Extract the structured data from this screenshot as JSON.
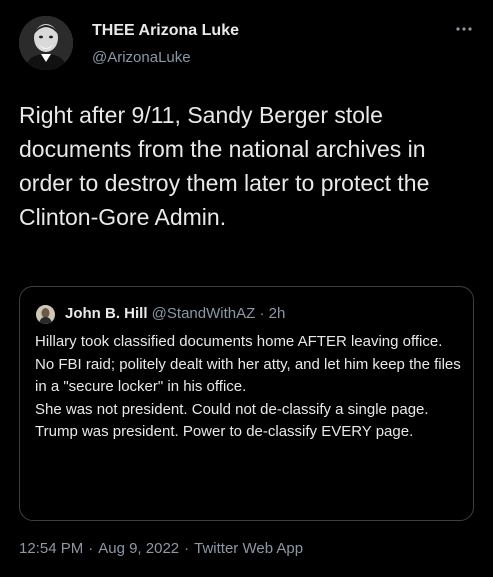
{
  "tweet": {
    "author": {
      "display_name": "THEE Arizona Luke",
      "handle": "@ArizonaLuke",
      "avatar_icon": "user-avatar"
    },
    "more_icon": "more-options-icon",
    "text": "Right after 9/11, Sandy Berger stole documents from the national archives in order to destroy them later to protect the Clinton-Gore Admin.",
    "quoted_tweet": {
      "display_name": "John B. Hill",
      "handle": "@StandWithAZ",
      "separator": "·",
      "time_ago": "2h",
      "paragraphs": [
        "Hillary took classified documents home AFTER leaving office. No FBI raid; politely dealt with her atty, and let him keep the files in a \"secure locker\" in his office.",
        "She was not president. Could not de-classify a single page. Trump was president. Power to de-classify EVERY page."
      ]
    },
    "footer": {
      "time": "12:54 PM",
      "date": "Aug 9, 2022",
      "source": "Twitter Web App",
      "separator": "·"
    }
  },
  "colors": {
    "background": "#000000",
    "text_primary": "#e7e9ea",
    "text_secondary": "#8b98a5",
    "border": "#3a3f44"
  }
}
